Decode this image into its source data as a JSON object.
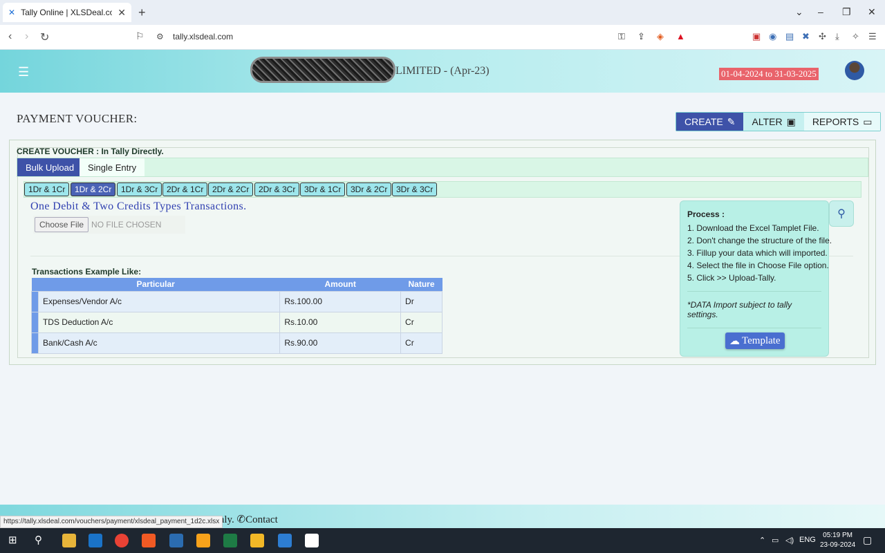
{
  "browser": {
    "tab_title": "Tally Online | XLSDeal.com",
    "url": "tally.xlsdeal.com",
    "status_url": "https://tally.xlsdeal.com/vouchers/payment/xlsdeal_payment_1d2c.xlsx"
  },
  "header": {
    "company_suffix": "LIMITED  -  (Apr-23)",
    "fiscal_year": "01-04-2024  to  31-03-2025"
  },
  "page": {
    "title": "PAYMENT VOUCHER:",
    "actions": {
      "create": "CREATE",
      "alter": "ALTER",
      "reports": "REPORTS"
    },
    "create_label": "CREATE VOUCHER : In Tally Directly.",
    "modes": {
      "bulk": "Bulk Upload",
      "single": "Single Entry"
    },
    "types": [
      "1Dr & 1Cr",
      "1Dr & 2Cr",
      "1Dr & 3Cr",
      "2Dr & 1Cr",
      "2Dr & 2Cr",
      "2Dr & 3Cr",
      "3Dr & 1Cr",
      "3Dr & 2Cr",
      "3Dr & 3Cr"
    ],
    "selected_type": "1Dr & 2Cr",
    "subtitle": "One Debit & Two Credits Types Transactions.",
    "file": {
      "button": "Choose File",
      "status": "NO FILE CHOSEN"
    },
    "example": {
      "label": "Transactions Example Like:",
      "columns": [
        "Particular",
        "Amount",
        "Nature"
      ],
      "rows": [
        [
          "Expenses/Vendor A/c",
          "Rs.100.00",
          "Dr"
        ],
        [
          "TDS Deduction A/c",
          "Rs.10.00",
          "Cr"
        ],
        [
          "Bank/Cash A/c",
          "Rs.90.00",
          "Cr"
        ]
      ]
    },
    "process": {
      "heading": "Process :",
      "steps": [
        "1. Download the Excel Tamplet File.",
        "2. Don't change the structure of the file.",
        "3. Fillup your data which will imported.",
        "4. Select the file in Choose File option.",
        "5. Click >> Upload-Tally."
      ],
      "note": "*DATA Import subject to tally settings.",
      "template_button": "Template"
    }
  },
  "footer": {
    "text": "Only. ✆Contact"
  },
  "taskbar": {
    "lang": "ENG",
    "time": "05:19 PM",
    "date": "23-09-2024"
  }
}
